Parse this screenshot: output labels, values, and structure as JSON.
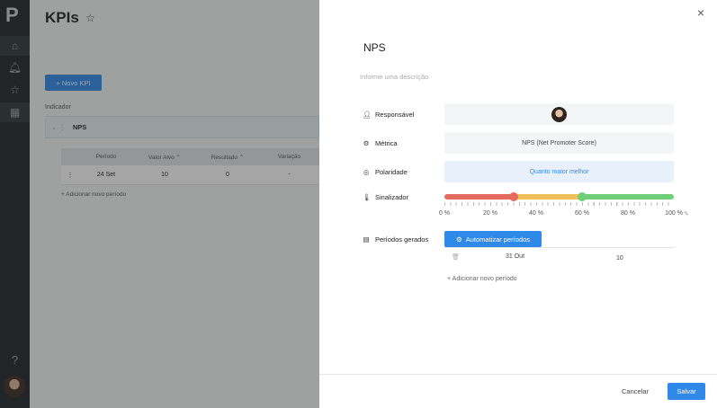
{
  "rail": {
    "logo": "P",
    "icons": [
      "home-icon",
      "bell-icon",
      "star-icon",
      "grid-icon"
    ],
    "help": "?"
  },
  "page": {
    "title": "KPIs",
    "new_kpi": "+ Novo KPI",
    "indicator_header": "Indicador",
    "kpi_row": {
      "expand": "⌄ ⋮",
      "name": "NPS"
    },
    "table": {
      "headers": [
        "Período",
        "Valor Alvo ⌃",
        "Resultado ⌃",
        "Variação"
      ],
      "row": {
        "menu": "⋮",
        "periodo": "24 Set",
        "valor_alvo": "10",
        "resultado": "0",
        "variacao": "-"
      }
    },
    "add_period": "+ Adicionar novo período"
  },
  "panel": {
    "close": "×",
    "title": "NPS",
    "description_placeholder": "Informe uma descrição",
    "fields": {
      "responsavel": {
        "label": "Responsável"
      },
      "metrica": {
        "label": "Métrica",
        "value": "NPS (Net Promoter Score)"
      },
      "polaridade": {
        "label": "Polaridade",
        "value": "Quanto maior melhor"
      },
      "sinalizador": {
        "label": "Sinalizador",
        "thresholds_percent": [
          30,
          60
        ],
        "colors": {
          "red": "#e46b5e",
          "yellow": "#f2c05a",
          "green": "#6fcf78"
        },
        "tick_labels": [
          "0 %",
          "20 %",
          "40 %",
          "60 %",
          "80 %",
          "100 %"
        ]
      },
      "periodos": {
        "label": "Períodos gerados",
        "automate": "Automatizar períodos",
        "row": {
          "date": "31 Out",
          "value": "10"
        },
        "add": "+ Adicionar novo período"
      }
    },
    "footer": {
      "cancel": "Cancelar",
      "save": "Salvar"
    }
  },
  "accent": "#2f89e8"
}
